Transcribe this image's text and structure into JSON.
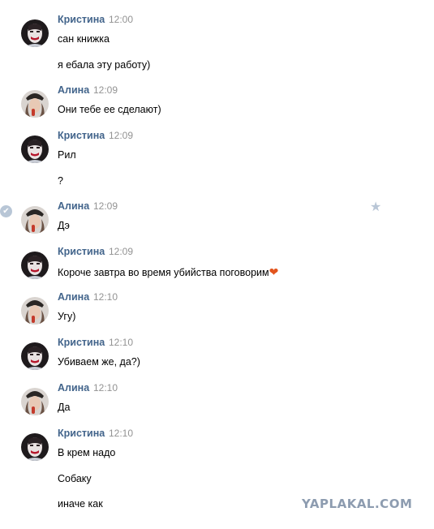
{
  "messages": [
    {
      "author": "Кристина",
      "avatar": "kristina",
      "time": "12:00",
      "lines": [
        "сан книжка",
        "я ебала эту работу)"
      ]
    },
    {
      "author": "Алина",
      "avatar": "alina",
      "time": "12:09",
      "lines": [
        "Они тебе ее сделают)"
      ]
    },
    {
      "author": "Кристина",
      "avatar": "kristina",
      "time": "12:09",
      "lines": [
        "Рил",
        "?"
      ]
    },
    {
      "author": "Алина",
      "avatar": "alina",
      "time": "12:09",
      "lines": [
        "Дэ"
      ]
    },
    {
      "author": "Кристина",
      "avatar": "kristina",
      "time": "12:09",
      "lines": [
        "Короче завтра во время убийства поговорим"
      ]
    },
    {
      "author": "Алина",
      "avatar": "alina",
      "time": "12:10",
      "lines": [
        "Угу)"
      ]
    },
    {
      "author": "Кристина",
      "avatar": "kristina",
      "time": "12:10",
      "lines": [
        "Убиваем же, да?)"
      ]
    },
    {
      "author": "Алина",
      "avatar": "alina",
      "time": "12:10",
      "lines": [
        "Да"
      ]
    },
    {
      "author": "Кристина",
      "avatar": "kristina",
      "time": "12:10",
      "lines": [
        "В крем надо",
        "Собаку",
        "иначе как"
      ]
    }
  ],
  "selected_indicator_icon": "check-circle-icon",
  "favorite_icon": "star-icon",
  "emoji_icon": "orange-heart-icon",
  "watermark": "YAPLAKAL.COM",
  "colors": {
    "author": "#42648b",
    "time": "#939393",
    "text": "#000000",
    "watermark": "#8d9cb0"
  }
}
